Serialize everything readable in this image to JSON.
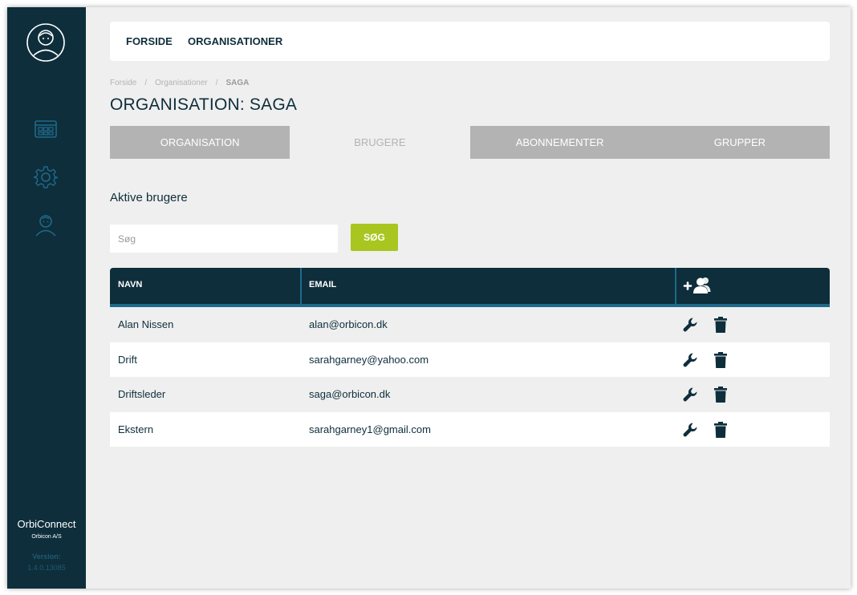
{
  "sidebar": {
    "brand_name": "OrbiConnect",
    "company": "Orbicon A/S",
    "version_label": "Version:",
    "version_value": "1.4.0.13085",
    "icons": [
      "avatar-icon",
      "dashboard-icon",
      "gear-icon",
      "users-icon"
    ]
  },
  "topnav": {
    "home": "FORSIDE",
    "organisations": "ORGANISATIONER"
  },
  "breadcrumb": {
    "items": [
      "Forside",
      "Organisationer",
      "SAGA"
    ],
    "separator": "/"
  },
  "page_title": "ORGANISATION: SAGA",
  "tabs": [
    {
      "label": "ORGANISATION",
      "active": false
    },
    {
      "label": "BRUGERE",
      "active": true
    },
    {
      "label": "ABONNEMENTER",
      "active": false
    },
    {
      "label": "GRUPPER",
      "active": false
    }
  ],
  "section_title": "Aktive brugere",
  "search": {
    "placeholder": "Søg",
    "button_label": "SØG"
  },
  "table": {
    "headers": {
      "name": "NAVN",
      "email": "EMAIL"
    },
    "rows": [
      {
        "name": "Alan Nissen",
        "email": "alan@orbicon.dk"
      },
      {
        "name": "Drift",
        "email": "sarahgarney@yahoo.com"
      },
      {
        "name": "Driftsleder",
        "email": "saga@orbicon.dk"
      },
      {
        "name": "Ekstern",
        "email": "sarahgarney1@gmail.com"
      }
    ]
  },
  "colors": {
    "sidebar": "#0e2e3b",
    "accent_button": "#a9c51f",
    "tab_inactive": "#b3b3b3",
    "header_underline": "#1f6a8a",
    "background": "#efefef"
  }
}
